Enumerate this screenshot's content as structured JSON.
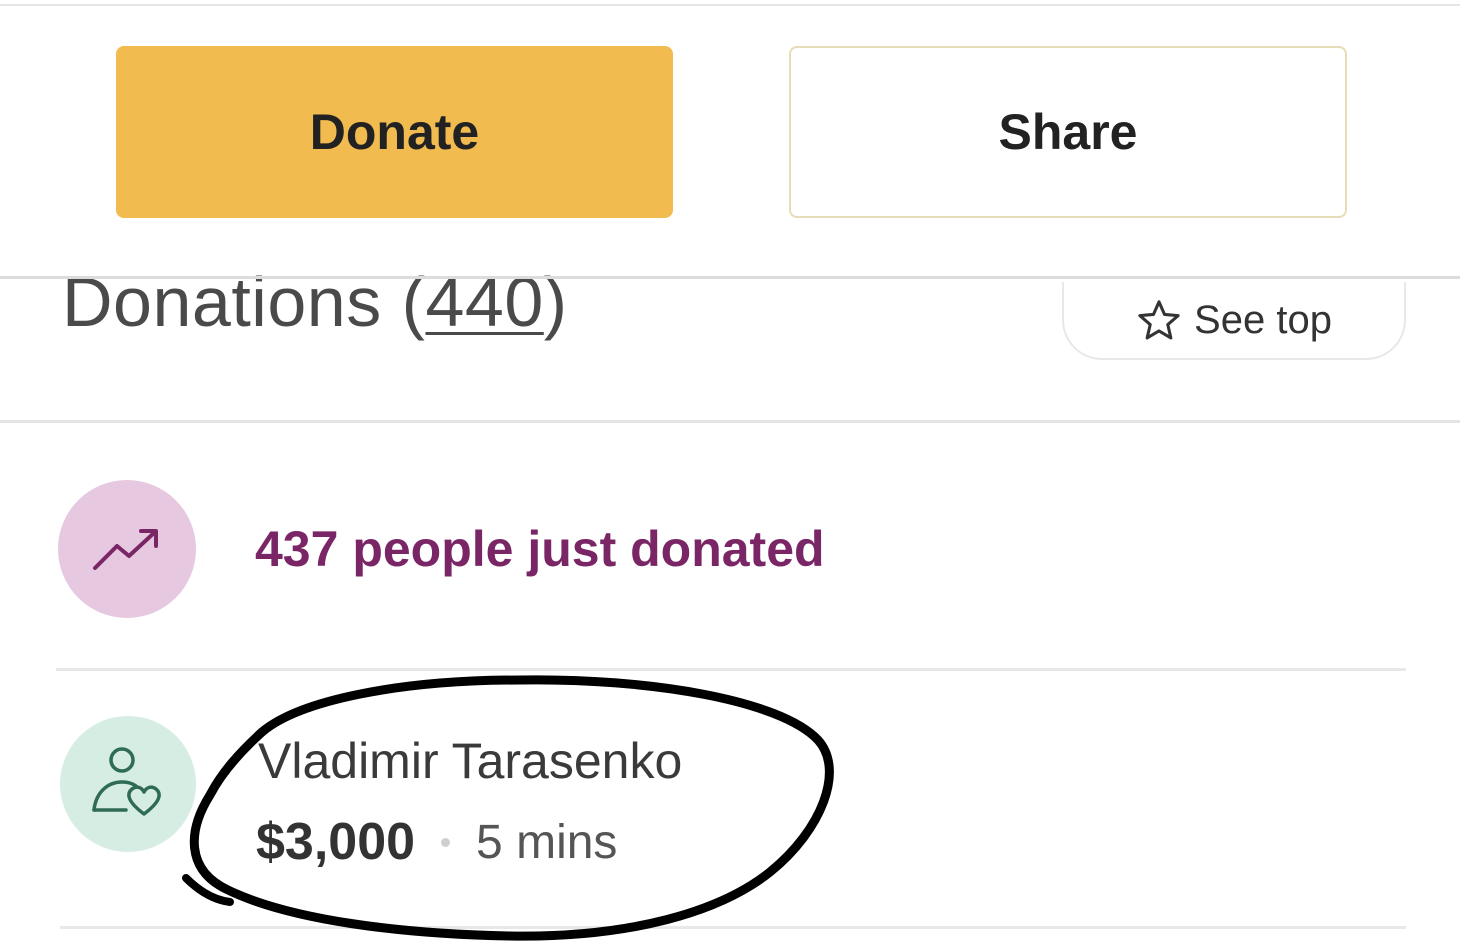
{
  "actions": {
    "donate_label": "Donate",
    "share_label": "Share"
  },
  "donations": {
    "heading_prefix": "Donations (",
    "count": "440",
    "heading_suffix": ")",
    "see_top_label": "See top",
    "see_top_icon": "star-outline-icon"
  },
  "activity": {
    "icon": "trending-up-icon",
    "text": "437 people just donated",
    "accent_color": "#7a2566",
    "icon_bg": "#e6c8e0"
  },
  "donor": {
    "icon": "donor-heart-icon",
    "name": "Vladimir Tarasenko",
    "amount": "$3,000",
    "time": "5 mins",
    "icon_bg": "#d6ede4"
  },
  "colors": {
    "donate_button": "#f2bb4f",
    "annotation_ink": "#000000"
  }
}
